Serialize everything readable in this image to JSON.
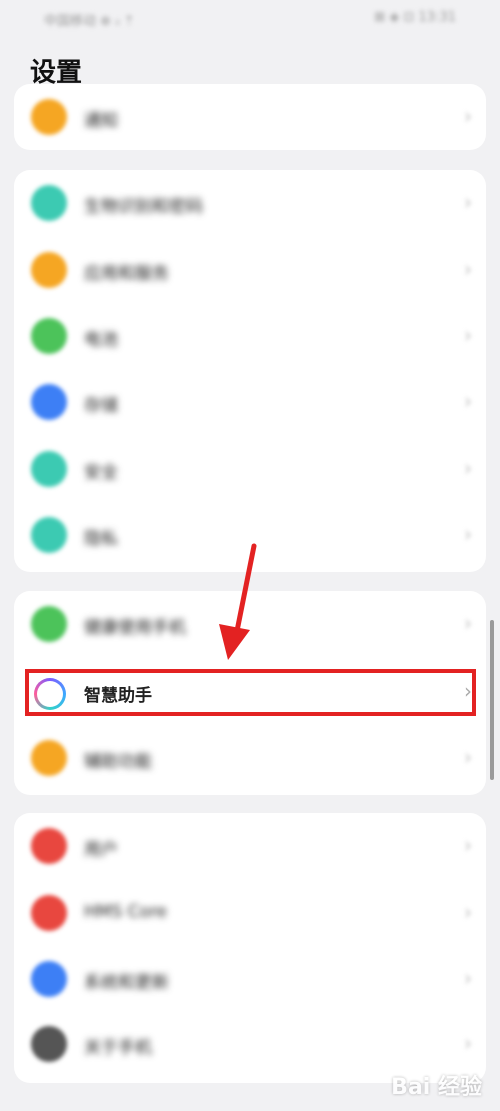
{
  "status_bar": {
    "left": "中国移动 ⊕ ᵢₗ ⇡",
    "right": "⊠ ◈ ⊡ 13:31"
  },
  "title": "设置",
  "arrow_color": "#e32222",
  "highlight_color": "#e32222",
  "cards": [
    {
      "rows": [
        {
          "label": "通知",
          "icon": "bell-icon",
          "color": "#f5a623"
        }
      ]
    },
    {
      "rows": [
        {
          "label": "生物识别和密码",
          "icon": "key-icon",
          "color": "#3ccab2"
        },
        {
          "label": "应用和服务",
          "icon": "apps-icon",
          "color": "#f5a623"
        },
        {
          "label": "电池",
          "icon": "battery-icon",
          "color": "#4cc35a"
        },
        {
          "label": "存储",
          "icon": "storage-icon",
          "color": "#3d7ff5"
        },
        {
          "label": "安全",
          "icon": "shield-icon",
          "color": "#3ccab2"
        },
        {
          "label": "隐私",
          "icon": "privacy-icon",
          "color": "#3ccab2"
        }
      ]
    },
    {
      "rows": [
        {
          "label": "健康使用手机",
          "icon": "health-icon",
          "color": "#4cc35a"
        },
        {
          "label": "智慧助手",
          "icon": "smart-assistant-icon",
          "color": "#7c5cff",
          "clear": true
        },
        {
          "label": "辅助功能",
          "icon": "accessibility-icon",
          "color": "#f5a623"
        }
      ]
    },
    {
      "rows": [
        {
          "label": "用户",
          "icon": "user-icon",
          "color": "#e8473f"
        },
        {
          "label": "HMS Core",
          "icon": "hms-core-icon",
          "color": "#e8473f"
        },
        {
          "label": "系统和更新",
          "icon": "system-update-icon",
          "color": "#3d7ff5"
        },
        {
          "label": "关于手机",
          "icon": "phone-info-icon",
          "color": "#555555"
        }
      ]
    }
  ],
  "chevron": "›",
  "watermark": "Bai 经验"
}
